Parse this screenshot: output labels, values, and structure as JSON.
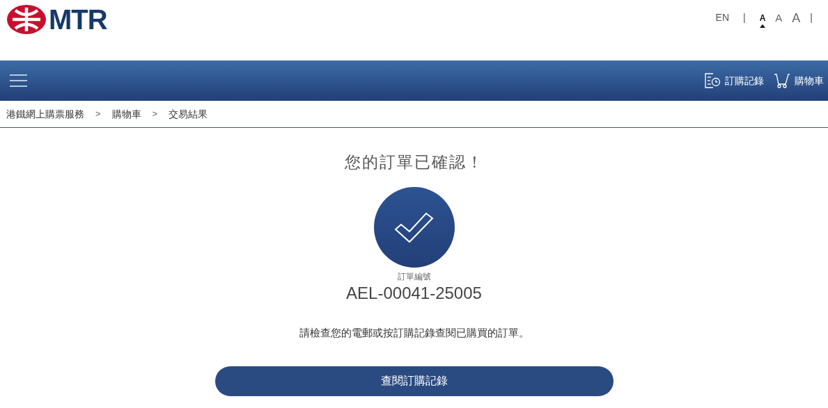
{
  "logo": {
    "text": "MTR"
  },
  "top_bar": {
    "language": "EN",
    "separator_left": "|",
    "font_sizes": [
      {
        "label": "A",
        "selected": true
      },
      {
        "label": "A",
        "selected": false
      },
      {
        "label": "A",
        "selected": false
      }
    ],
    "separator_right": "|"
  },
  "nav": {
    "links": [
      {
        "kind": "orders",
        "label": "訂購記錄"
      },
      {
        "kind": "cart",
        "label": "購物車"
      }
    ]
  },
  "breadcrumb": {
    "items": [
      "港鐵網上購票服務",
      "購物車",
      "交易結果"
    ],
    "separator": ">"
  },
  "confirmation": {
    "title": "您的訂單已確認！",
    "order_label": "訂單編號",
    "order_number": "AEL-00041-25005",
    "message": "請檢查您的電郵或按訂購記錄查閱已購買的訂單。",
    "button": "查閱訂購記錄"
  }
}
